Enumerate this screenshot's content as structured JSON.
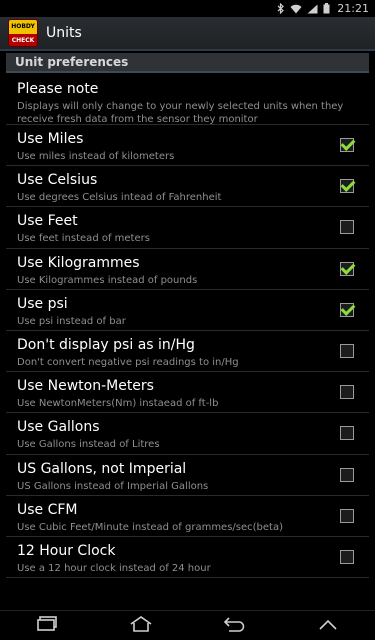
{
  "status_bar": {
    "time": "21:21",
    "icons": [
      "bluetooth-icon",
      "wifi-icon",
      "signal-icon",
      "battery-icon"
    ]
  },
  "action_bar": {
    "app_logo_text_top": "HOBDY",
    "app_logo_text_bottom": "CHECK",
    "title": "Units"
  },
  "section": {
    "header": "Unit preferences"
  },
  "note": {
    "title": "Please note",
    "text": "Displays will only change to your newly selected units when they receive fresh data from the sensor they monitor"
  },
  "preferences": [
    {
      "title": "Use Miles",
      "summary": "Use miles instead of kilometers",
      "checked": true
    },
    {
      "title": "Use Celsius",
      "summary": "Use degrees Celsius intead of Fahrenheit",
      "checked": true
    },
    {
      "title": "Use Feet",
      "summary": "Use feet instead of meters",
      "checked": false
    },
    {
      "title": "Use Kilogrammes",
      "summary": "Use Kilogrammes instead of pounds",
      "checked": true
    },
    {
      "title": "Use psi",
      "summary": "Use psi instead of bar",
      "checked": true
    },
    {
      "title": "Don't display psi as in/Hg",
      "summary": "Don't convert negative psi readings to in/Hg",
      "checked": false
    },
    {
      "title": "Use Newton-Meters",
      "summary": "Use NewtonMeters(Nm) instaead of ft-lb",
      "checked": false
    },
    {
      "title": "Use Gallons",
      "summary": "Use Gallons instead of Litres",
      "checked": false
    },
    {
      "title": "US Gallons, not Imperial",
      "summary": "US Gallons instead of Imperial Gallons",
      "checked": false
    },
    {
      "title": "Use CFM",
      "summary": "Use Cubic Feet/Minute instead of grammes/sec(beta)",
      "checked": false
    },
    {
      "title": "12 Hour Clock",
      "summary": "Use a 12 hour clock instead of 24 hour",
      "checked": false
    }
  ],
  "nav_bar": {
    "buttons": [
      "recent-apps-icon",
      "home-icon",
      "back-icon",
      "menu-up-icon"
    ]
  },
  "colors": {
    "check_green": "#8cdd3a",
    "header_bg": "#2f3338",
    "background": "#000000"
  }
}
